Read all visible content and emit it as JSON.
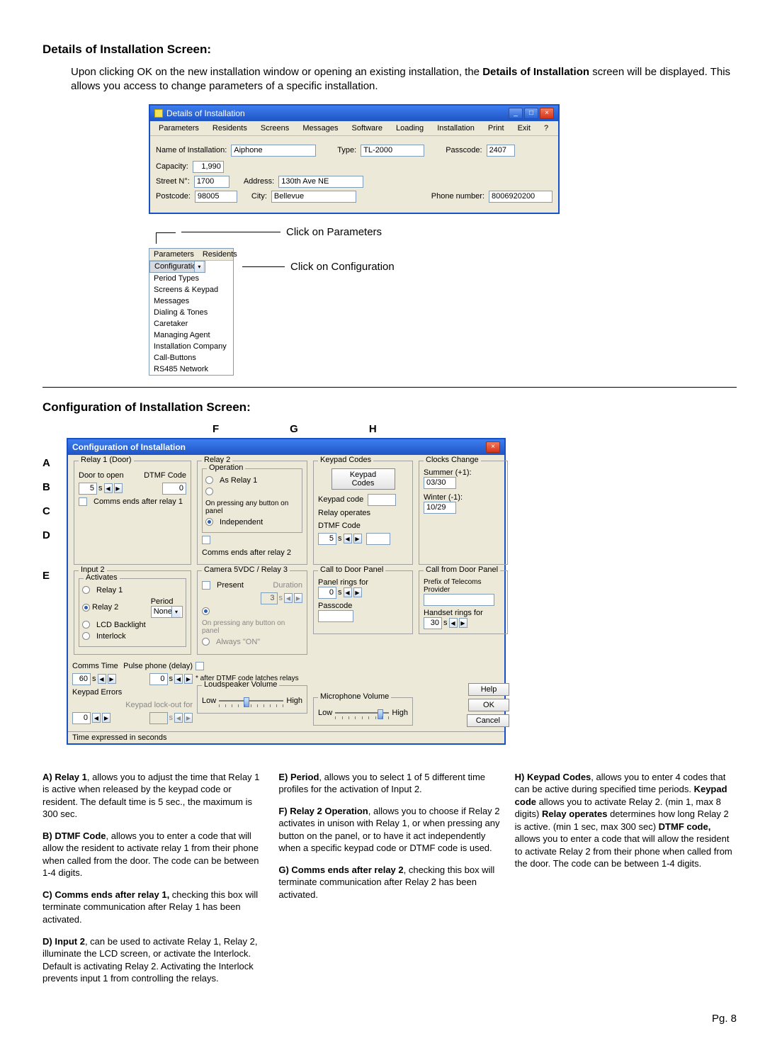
{
  "sec1": {
    "heading": "Details of Installation Screen:",
    "intro_a": "Upon clicking OK on the new installation window or opening an existing installation, the ",
    "intro_b": "Details of Installation",
    "intro_c": " screen will be displayed.  This allows you access to change parameters of a specific installation."
  },
  "details_win": {
    "title": "Details of Installation",
    "menu": [
      "Parameters",
      "Residents",
      "Screens",
      "Messages",
      "Software",
      "Loading",
      "Installation",
      "Print",
      "Exit",
      "?"
    ],
    "fields": {
      "name_lbl": "Name of Installation:",
      "name_val": "Aiphone",
      "type_lbl": "Type:",
      "type_val": "TL-2000",
      "passcode_lbl": "Passcode:",
      "passcode_val": "2407",
      "capacity_lbl": "Capacity:",
      "capacity_val": "1,990",
      "street_lbl": "Street N°:",
      "street_val": "1700",
      "address_lbl": "Address:",
      "address_val": "130th Ave NE",
      "postcode_lbl": "Postcode:",
      "postcode_val": "98005",
      "city_lbl": "City:",
      "city_val": "Bellevue",
      "phone_lbl": "Phone number:",
      "phone_val": "8006920200"
    }
  },
  "drop": {
    "click_params": "Click on Parameters",
    "click_config": "Click on Configuration",
    "head": [
      "Parameters",
      "Residents"
    ],
    "items": [
      "Configuration",
      "Period Types",
      "Screens & Keypad",
      "Messages",
      "Dialing & Tones",
      "Caretaker",
      "Managing Agent",
      "Installation Company",
      "Call-Buttons",
      "RS485 Network"
    ]
  },
  "sec2": {
    "heading": "Configuration of Installation Screen:"
  },
  "letters_top": [
    "F",
    "G",
    "H"
  ],
  "letters_side": [
    "A",
    "B",
    "C",
    "D",
    "E"
  ],
  "cfg": {
    "title": "Configuration of Installation",
    "relay1": {
      "legend": "Relay 1 (Door)",
      "door_open": "Door to open",
      "dtmf": "DTMF Code",
      "door_val": "5",
      "dtmf_val": "0",
      "comms": "Comms ends after relay 1"
    },
    "relay2": {
      "legend": "Relay 2",
      "op_legend": "Operation",
      "op_as": "As Relay 1",
      "op_press": "On pressing any button on panel",
      "op_ind": "Independent",
      "comms": "Comms ends after relay 2"
    },
    "keypad": {
      "legend": "Keypad Codes",
      "code": "Keypad code",
      "relay_op": "Relay operates",
      "dtmf": "DTMF Code",
      "relay_val": "5"
    },
    "clocks": {
      "legend": "Clocks Change",
      "summer": "Summer (+1):",
      "summer_v": "03/30",
      "winter": "Winter (-1):",
      "winter_v": "10/29"
    },
    "input2": {
      "legend": "Input 2",
      "activates": "Activates",
      "r1": "Relay 1",
      "r2": "Relay 2",
      "lcd": "LCD Backlight",
      "inter": "Interlock",
      "period": "Period",
      "period_v": "None"
    },
    "cam": {
      "legend": "Camera 5VDC / Relay 3",
      "present": "Present",
      "dur": "Duration",
      "dur_v": "3",
      "op_press": "On pressing any button on panel",
      "op_always": "Always \"ON\""
    },
    "call_to": {
      "legend": "Call to Door Panel",
      "rings": "Panel rings for",
      "v": "0",
      "pass": "Passcode"
    },
    "call_from": {
      "legend": "Call from Door Panel",
      "prefix": "Prefix of Telecoms Provider",
      "hrings": "Handset rings for",
      "v": "30"
    },
    "comms_time": {
      "lbl": "Comms Time",
      "v": "60",
      "pulse": "Pulse phone (delay)",
      "pv": "0",
      "star": "* after DTMF code latches relays"
    },
    "keypad_err": {
      "lbl": "Keypad Errors",
      "v": "0",
      "lock": "Keypad lock-out for",
      "lv": ""
    },
    "loud": {
      "legend": "Loudspeaker Volume",
      "low": "Low",
      "high": "High"
    },
    "mic": {
      "legend": "Microphone Volume",
      "low": "Low",
      "high": "High"
    },
    "help": "Help",
    "ok": "OK",
    "cancel": "Cancel",
    "status": "Time expressed in seconds"
  },
  "desc": {
    "a_term": "A) Relay 1",
    "a_txt": ", allows you to adjust the time that Relay 1 is active when released by the keypad code or resident.  The default time is 5 sec., the maximum is 300 sec.",
    "b_term": "B) DTMF Code",
    "b_txt": ", allows you to enter a code that will allow the resident to activate relay 1 from their phone when called from the door. The code can be between 1-4 digits.",
    "c_term": "C) Comms ends after relay 1,",
    "c_txt": " checking this box will terminate communication after Relay 1 has been activated.",
    "d_term": "D) Input 2",
    "d_txt": ", can be used to activate Relay 1, Relay 2, illuminate the LCD screen, or activate the Interlock.  Default is activating Relay 2.  Activating the Interlock prevents input 1 from controlling the relays.",
    "e_term": "E) Period",
    "e_txt": ", allows you to select 1 of 5 different time profiles for the activation of Input 2.",
    "f_term": "F) Relay 2 Operation",
    "f_txt": ", allows you to choose if Relay 2 activates in unison with Relay 1, or when pressing any button on the panel, or to have it act independently when a specific keypad code or DTMF code is used.",
    "g_term": "G) Comms ends after relay 2",
    "g_txt": ", checking this box will terminate communication after Relay 2 has been activated.",
    "h_term": "H) Keypad Codes",
    "h_txt1": ", allows you to enter 4 codes that can be active during specified time periods.  ",
    "h_bold2": "Keypad code",
    "h_txt2": " allows you to activate Relay 2. (min 1, max 8 digits) ",
    "h_bold3": "Relay operates",
    "h_txt3": " determines how long Relay 2 is active. (min 1 sec, max 300 sec) ",
    "h_bold4": "DTMF code,",
    "h_txt4": " allows you to enter a code that will allow the resident to activate Relay 2 from their phone when called from the door. The code can be between 1-4 digits."
  },
  "pg": "Pg. 8"
}
